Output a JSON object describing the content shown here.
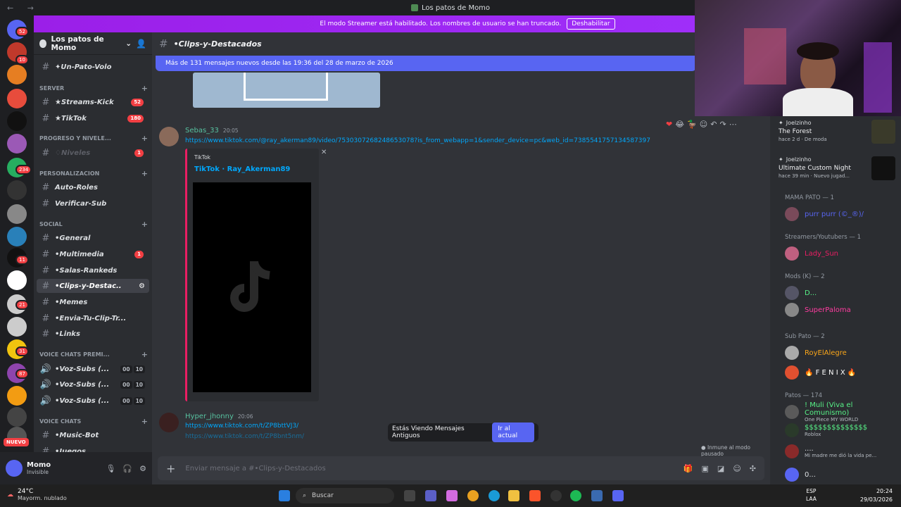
{
  "window": {
    "title": "Los patos de Momo",
    "nav": "← →"
  },
  "banner": {
    "text": "El modo Streamer está habilitado. Los nombres de usuario se han truncado.",
    "button": "Deshabilitar"
  },
  "servers": {
    "badges": [
      "52",
      "10",
      "234",
      "11",
      "21",
      "31",
      "87"
    ],
    "nuevo": "NUEVO"
  },
  "guild": {
    "name": "Los patos de Momo"
  },
  "channels": [
    {
      "label": "✦Un-Pato-Volo",
      "kind": "text"
    },
    {
      "cat": "SERVER"
    },
    {
      "label": "★Streams-Kick",
      "badge": "52"
    },
    {
      "label": "★TikTok",
      "badge": "180"
    },
    {
      "cat": "PROGRESO Y NIVELE..."
    },
    {
      "label": "♢Niveles",
      "badge": "1",
      "muted": true
    },
    {
      "cat": "PERSONALIZACION"
    },
    {
      "label": "Auto-Roles"
    },
    {
      "label": "Verificar-Sub"
    },
    {
      "cat": "SOCIAL"
    },
    {
      "label": "•General"
    },
    {
      "label": "•Multimedia",
      "badge": "1"
    },
    {
      "label": "•Salas-Rankeds"
    },
    {
      "label": "•Clips-y-Destac..",
      "selected": true
    },
    {
      "label": "•Memes"
    },
    {
      "label": "•Envia-Tu-Clip-Tr..."
    },
    {
      "label": "•Links"
    },
    {
      "cat": "VOICE CHATS PREMI..."
    },
    {
      "label": "•Voz-Subs (...",
      "vc": [
        "00",
        "10"
      ]
    },
    {
      "label": "•Voz-Subs (...",
      "vc": [
        "00",
        "10"
      ]
    },
    {
      "label": "•Voz-Subs (...",
      "vc": [
        "00",
        "10"
      ]
    },
    {
      "cat": "VOICE CHATS"
    },
    {
      "label": "•Music-Bot"
    },
    {
      "label": "•Juegos"
    }
  ],
  "user": {
    "name": "Momo",
    "status": "Invisible"
  },
  "chat": {
    "channel": "•Clips-y-Destacados",
    "new_messages": "Más de 131 mensajes nuevos desde las 19:36 del 28 de marzo de 2026",
    "messages": [
      {
        "author": "Sebas_33",
        "time": "20:05",
        "link": "https://www.tiktok.com/@ray_akerman89/video/7530307268248653078?is_from_webapp=1&sender_device=pc&web_id=7385541757134587397"
      },
      {
        "author": "Hyper_jhonny",
        "time": "20:06",
        "link": "https://www.tiktok.com/t/ZP8bttVJ3/",
        "link2": "https://www.tiktok.com/t/ZP8bnt5nm/"
      }
    ],
    "embed": {
      "provider": "TikTok",
      "title": "TikTok · Ray_Akerman89"
    },
    "jump_text": "Estás Viendo Mensajes Antiguos",
    "jump_button": "Ir al actual",
    "paused": "Inmune al modo pausado",
    "composer_placeholder": "Enviar mensaje a #•Clips-y-Destacados"
  },
  "members": {
    "activities": [
      {
        "user": "Joelzinho",
        "game": "The Forest",
        "meta": "hace 2 d · De moda"
      },
      {
        "user": "Joelzinho",
        "game": "Ultimate Custom Night",
        "meta": "hace 39 min · Nuevo jugad..."
      }
    ],
    "groups": [
      {
        "title": "MAMA PATO — 1",
        "members": [
          {
            "name": "purr purr (©_®)/",
            "color": "#5865f2"
          }
        ]
      },
      {
        "title": "Streamers/Youtubers — 1",
        "members": [
          {
            "name": "Lady_Sun",
            "color": "#e91e63"
          }
        ]
      },
      {
        "title": "Mods (K) — 2",
        "members": [
          {
            "name": "D...",
            "color": "#57f287"
          },
          {
            "name": "SuperPaloma",
            "color": "#ff3ca0"
          }
        ]
      },
      {
        "title": "Sub Pato — 2",
        "members": [
          {
            "name": "RoyElAlegre",
            "color": "#faa61a"
          },
          {
            "name": "🔥 F E N I X 🔥",
            "color": "#ffffff"
          }
        ]
      },
      {
        "title": "Patos — 174",
        "members": [
          {
            "name": "! Muli (Viva el Comunismo)",
            "color": "#57f287",
            "sub": "One Piece MY WORLD"
          },
          {
            "name": "$$$$$$$$$$$$$$",
            "color": "#57f287",
            "sub": "Roblox"
          },
          {
            "name": "....",
            "color": "#dbdee1",
            "sub": "Mi madre me dió la vida pe..."
          },
          {
            "name": "0...",
            "color": "#dbdee1"
          }
        ]
      }
    ]
  },
  "taskbar": {
    "temp": "24°C",
    "weather": "Mayorm. nublado",
    "search": "Buscar",
    "lang": "ESP",
    "lang2": "LAA",
    "time": "20:24",
    "date": "29/03/2026"
  }
}
